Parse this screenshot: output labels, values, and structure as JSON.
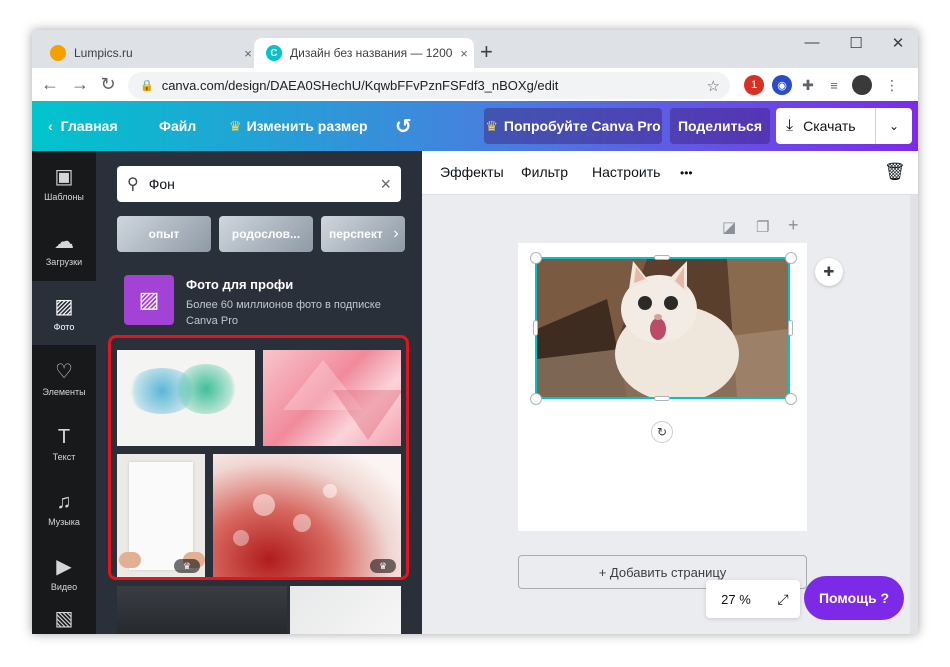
{
  "browser": {
    "tabs": [
      {
        "title": "Lumpics.ru",
        "close": "×"
      },
      {
        "title": "Дизайн без названия — 1200 ×",
        "close": "×"
      }
    ],
    "new_tab": "+",
    "window_controls": {
      "minimize": "—",
      "maximize": "☐",
      "close": "✕"
    },
    "nav": {
      "back": "←",
      "forward": "→",
      "reload": "↻"
    },
    "url": "canva.com/design/DAEA0SHechU/KqwbFFvPznFSFdf3_nBOXg/edit",
    "extension_badge": "1"
  },
  "header": {
    "home": "Главная",
    "file": "Файл",
    "resize": "Изменить размер",
    "try_pro": "Попробуйте Canva Pro",
    "share": "Поделиться",
    "download": "Скачать"
  },
  "rail": [
    {
      "label": "Шаблоны",
      "icon": "template-icon",
      "glyph": "▣"
    },
    {
      "label": "Загрузки",
      "icon": "upload-cloud-icon",
      "glyph": "☁"
    },
    {
      "label": "Фото",
      "icon": "photo-icon",
      "glyph": "▨"
    },
    {
      "label": "Элементы",
      "icon": "elements-icon",
      "glyph": "♡"
    },
    {
      "label": "Текст",
      "icon": "text-icon",
      "glyph": "T"
    },
    {
      "label": "Музыка",
      "icon": "music-icon",
      "glyph": "♫"
    },
    {
      "label": "Видео",
      "icon": "video-icon",
      "glyph": "▶"
    }
  ],
  "panel": {
    "search_value": "Фон",
    "chips": [
      "опыт",
      "родослов...",
      "перспект"
    ],
    "promo_title": "Фото для профи",
    "promo_desc": "Более 60 миллионов фото в подписке Canva Pro",
    "pro_crown": "♛"
  },
  "editor": {
    "tools": [
      "Эффекты",
      "Фильтр",
      "Настроить",
      "•••"
    ],
    "add_page": "+ Добавить страницу",
    "zoom": "27 %",
    "help": "Помощь ?"
  }
}
